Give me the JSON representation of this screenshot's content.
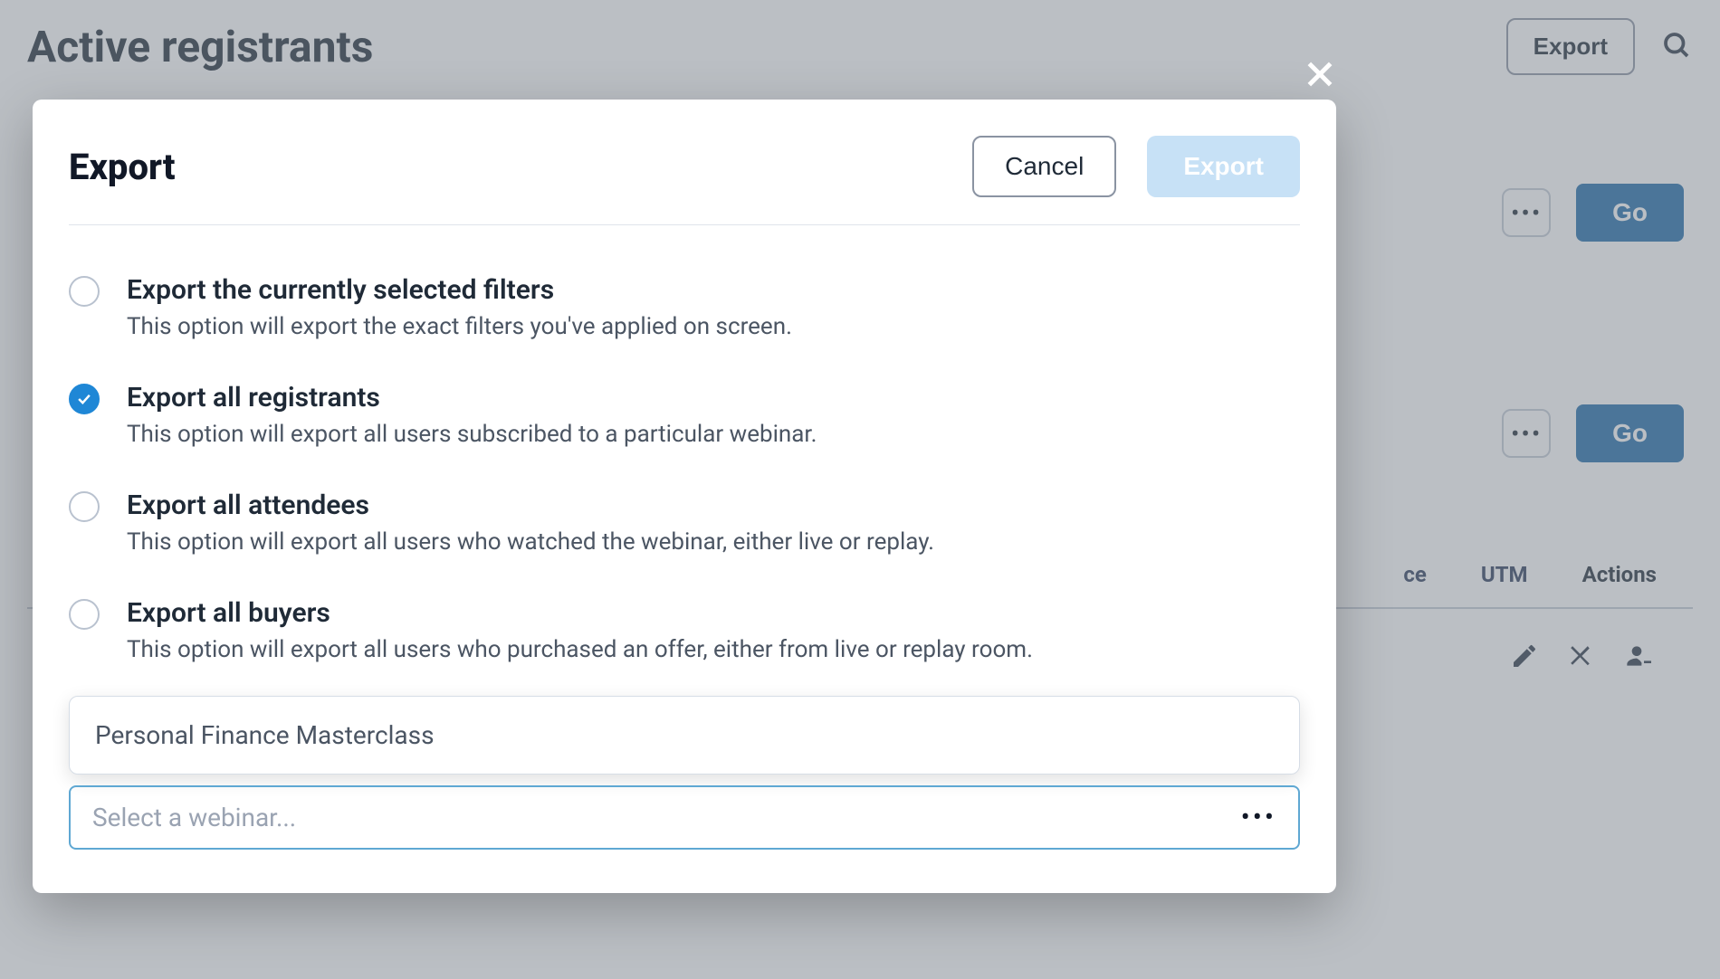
{
  "background": {
    "title": "Active registrants",
    "export_label": "Export",
    "go_label": "Go",
    "columns": {
      "c1_suffix": "ce",
      "c2": "UTM",
      "c3": "Actions"
    }
  },
  "modal": {
    "title": "Export",
    "cancel_label": "Cancel",
    "export_label": "Export",
    "options": [
      {
        "title": "Export the currently selected filters",
        "desc": "This option will export the exact filters you've applied on screen.",
        "selected": false
      },
      {
        "title": "Export all registrants",
        "desc": "This option will export all users subscribed to a particular webinar.",
        "selected": true
      },
      {
        "title": "Export all attendees",
        "desc": "This option will export all users who watched the webinar, either live or replay.",
        "selected": false
      },
      {
        "title": "Export all buyers",
        "desc": "This option will export all users who purchased an offer, either from live or replay room.",
        "selected": false
      }
    ],
    "dropdown_value": "Personal Finance Masterclass",
    "select_placeholder": "Select a webinar..."
  }
}
